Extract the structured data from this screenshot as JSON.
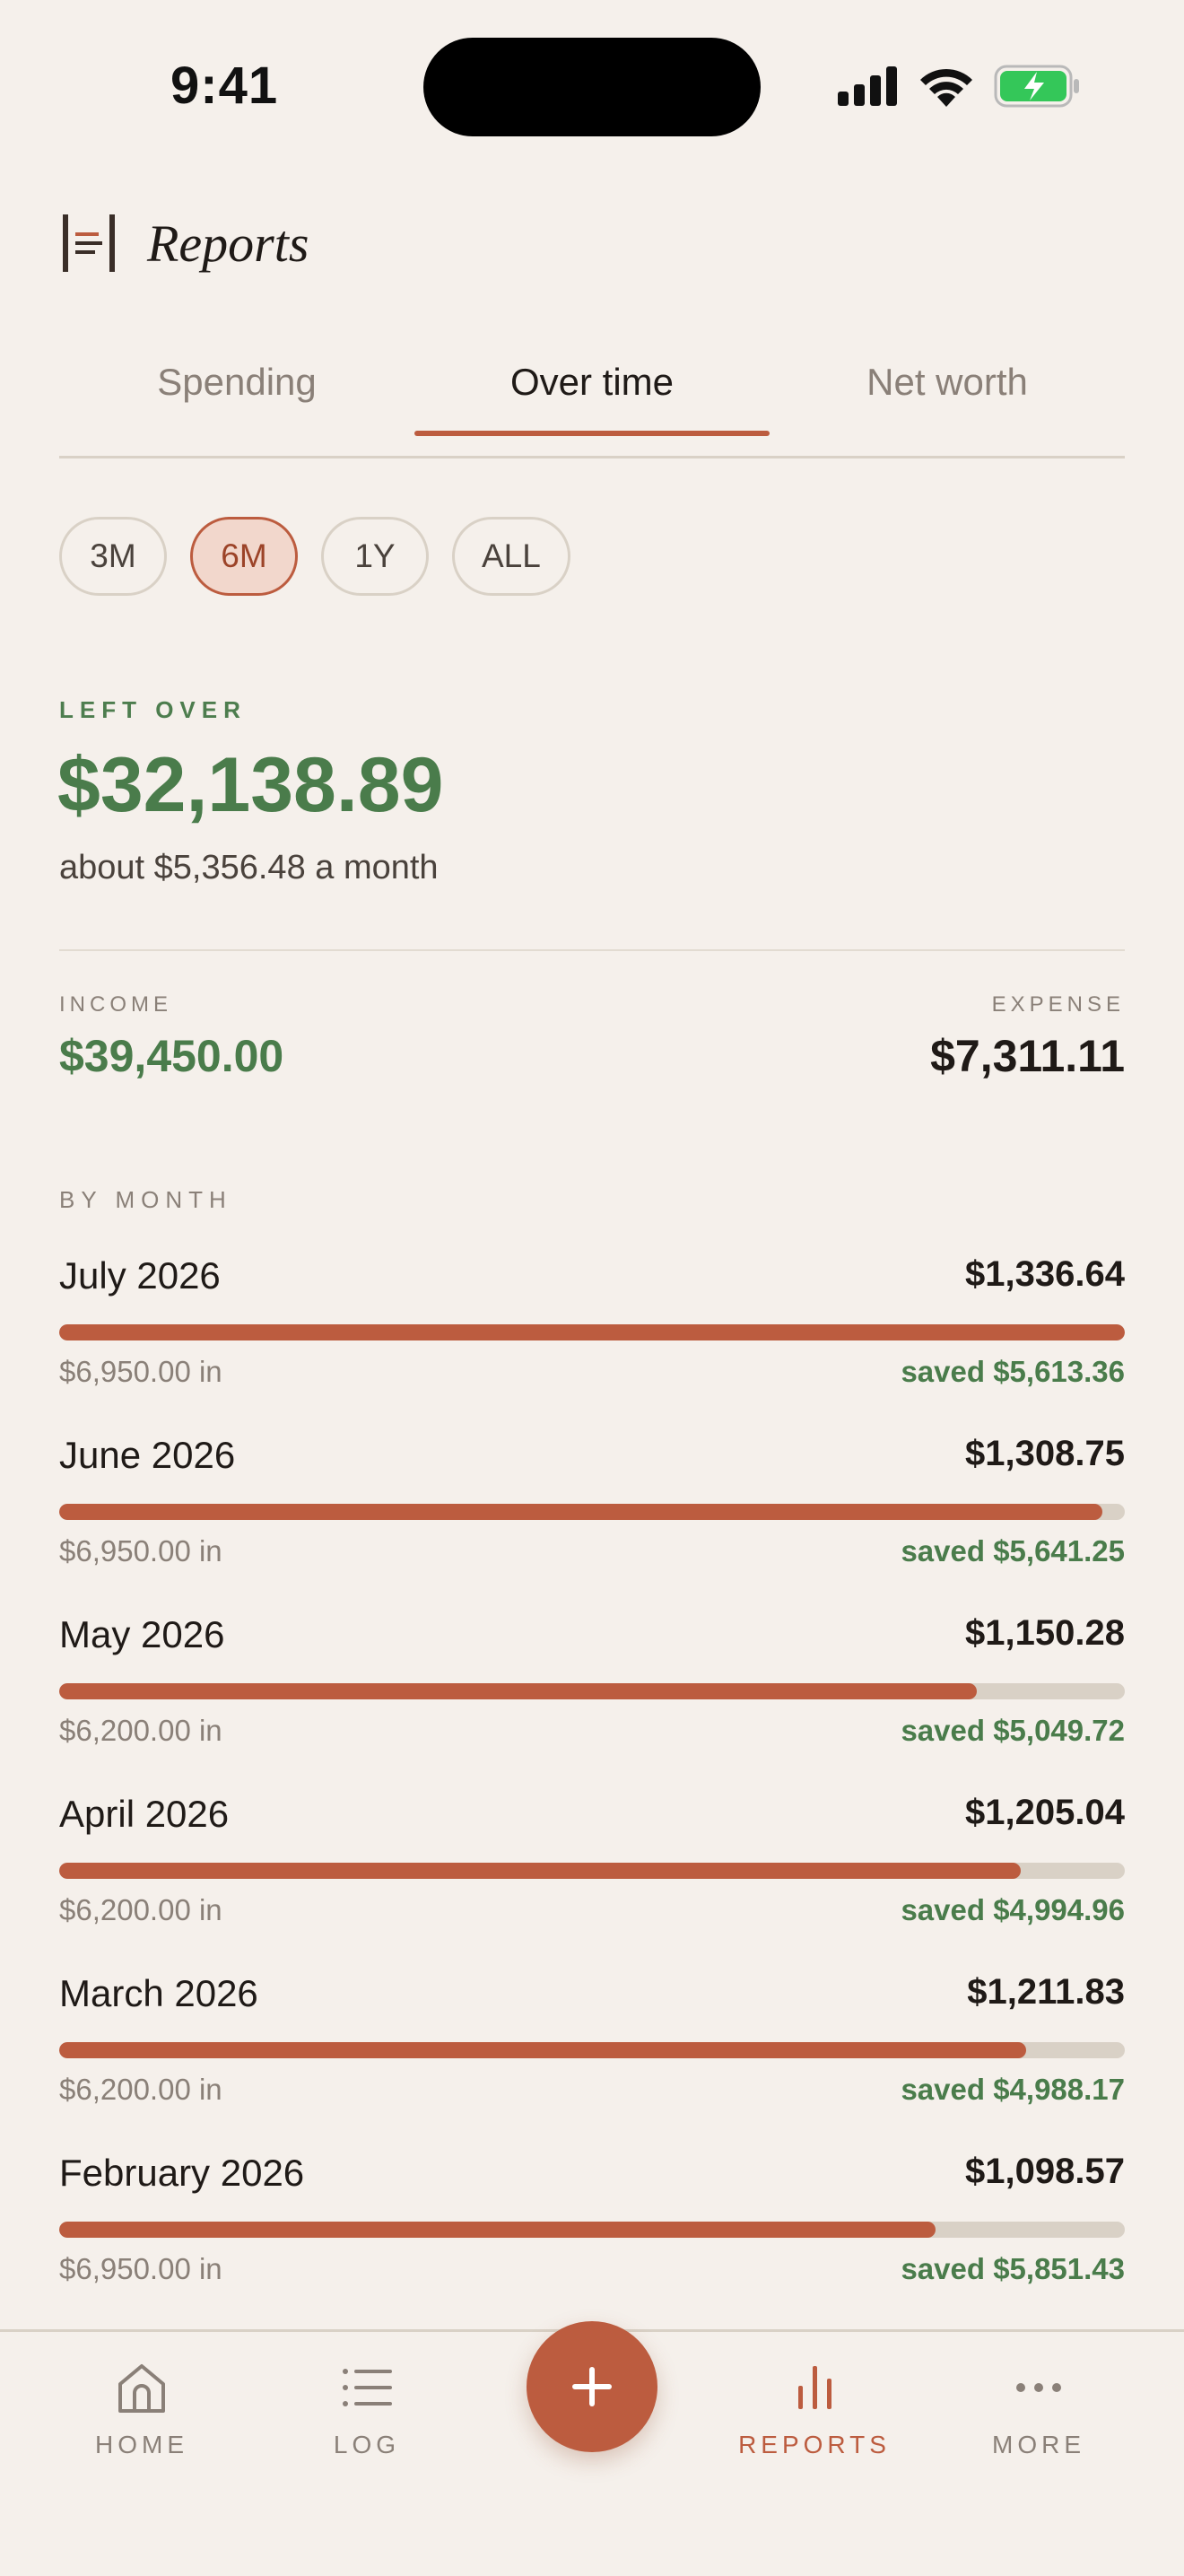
{
  "status_bar": {
    "time": "9:41"
  },
  "header": {
    "title": "Reports"
  },
  "tabs": [
    {
      "label": "Spending"
    },
    {
      "label": "Over time"
    },
    {
      "label": "Net worth"
    }
  ],
  "active_tab": "Over time",
  "ranges": [
    {
      "label": "3M"
    },
    {
      "label": "6M"
    },
    {
      "label": "1Y"
    },
    {
      "label": "ALL"
    }
  ],
  "active_range": "6M",
  "summary": {
    "left_over_label": "LEFT OVER",
    "left_over_value": "$32,138.89",
    "left_over_sub": "about $5,356.48 a month",
    "income_label": "INCOME",
    "income_value": "$39,450.00",
    "expense_label": "EXPENSE",
    "expense_value": "$7,311.11"
  },
  "by_month": {
    "label": "BY MONTH",
    "months": [
      {
        "name": "July 2026",
        "spent": "$1,336.64",
        "income": "$6,950.00 in",
        "saved": "saved $5,613.36",
        "fill_fraction": 1.0
      },
      {
        "name": "June 2026",
        "spent": "$1,308.75",
        "income": "$6,950.00 in",
        "saved": "saved $5,641.25",
        "fill_fraction": 0.979
      },
      {
        "name": "May 2026",
        "spent": "$1,150.28",
        "income": "$6,200.00 in",
        "saved": "saved $5,049.72",
        "fill_fraction": 0.861
      },
      {
        "name": "April 2026",
        "spent": "$1,205.04",
        "income": "$6,200.00 in",
        "saved": "saved $4,994.96",
        "fill_fraction": 0.902
      },
      {
        "name": "March 2026",
        "spent": "$1,211.83",
        "income": "$6,200.00 in",
        "saved": "saved $4,988.17",
        "fill_fraction": 0.907
      },
      {
        "name": "February 2026",
        "spent": "$1,098.57",
        "income": "$6,950.00 in",
        "saved": "saved $5,851.43",
        "fill_fraction": 0.822
      }
    ]
  },
  "bottom_nav": {
    "home": "HOME",
    "log": "LOG",
    "reports": "REPORTS",
    "more": "MORE"
  },
  "colors": {
    "accent": "#bc5c3f",
    "positive": "#4a7c4b",
    "background": "#f5f0eb",
    "track": "#d9d1c6"
  }
}
